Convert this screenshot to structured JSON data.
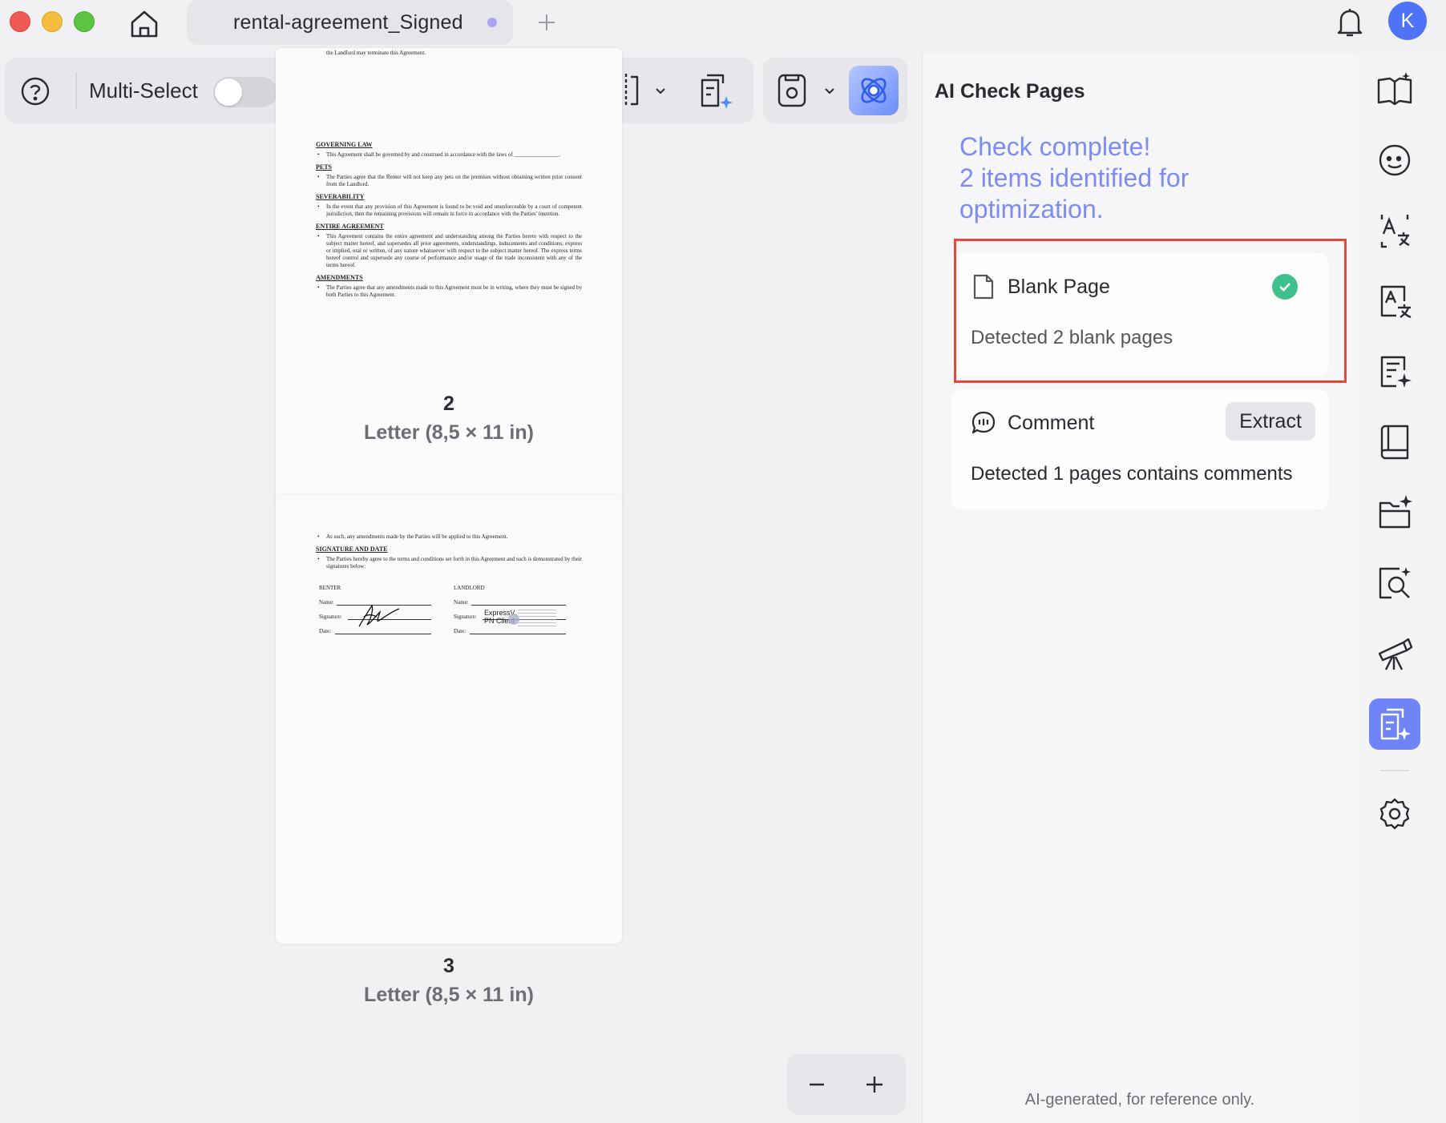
{
  "tab": {
    "title": "rental-agreement_Signed"
  },
  "user": {
    "avatar_initial": "K"
  },
  "toolbar": {
    "multi_select_label": "Multi-Select"
  },
  "pages": [
    {
      "number": "2",
      "size": "Letter (8,5 × 11 in)",
      "partial_top_line": "the Landlord may terminate this Agreement.",
      "sections": [
        {
          "heading": "GOVERNING LAW",
          "text": "This Agreement shall be governed by and construed in accordance with the laws of ________________."
        },
        {
          "heading": "PETS",
          "text": "The Parties agree that the Renter will not keep any pets on the premises without obtaining written prior consent from the Landlord."
        },
        {
          "heading": "SEVERABILITY",
          "text": "In the event that any provision of this Agreement is found to be void and unenforceable by a court of competent jurisdiction, then the remaining provisions will remain in force in accordance with the Parties' intention."
        },
        {
          "heading": "ENTIRE AGREEMENT",
          "text": "This Agreement contains the entire agreement and understanding among the Parties hereto with respect to the subject matter hereof, and supersedes all prior agreements, understandings, inducements and conditions, express or implied, oral or written, of any nature whatsoever with respect to the subject matter hereof. The express terms hereof control and supersede any course of performance and/or usage of the trade inconsistent with any of the terms hereof."
        },
        {
          "heading": "AMENDMENTS",
          "text": "The Parties agree that any amendments made to this Agreement must be in writing, where they must be signed by both Parties to this Agreement."
        }
      ]
    },
    {
      "number": "3",
      "size": "Letter (8,5 × 11 in)",
      "intro": "As such, any amendments made by the Parties will be applied to this Agreement.",
      "heading": "SIGNATURE AND DATE",
      "text": "The Parties hereby agree to the terms and conditions set forth in this Agreement and such is demonstrated by their signatures below:",
      "renter_label": "RENTER",
      "landlord_label": "LANDLORD",
      "name_label": "Name:",
      "signature_label": "Signature:",
      "date_label": "Date:",
      "stamp_line1": "ExpressV",
      "stamp_line2": "PN Client"
    }
  ],
  "panel": {
    "title": "AI Check Pages",
    "check_title": "Check complete!",
    "check_detail": "2 items identified for optimization.",
    "items": [
      {
        "title": "Blank Page",
        "description": "Detected 2 blank pages",
        "status": "checked"
      },
      {
        "title": "Comment",
        "description": "Detected 1 pages contains comments",
        "action": "Extract"
      }
    ],
    "footer": "AI-generated, for reference only."
  },
  "colors": {
    "accent": "#6f84f6",
    "check_text": "#7c8cf2",
    "success": "#3fbf8c",
    "highlight": "#e34a3a"
  }
}
